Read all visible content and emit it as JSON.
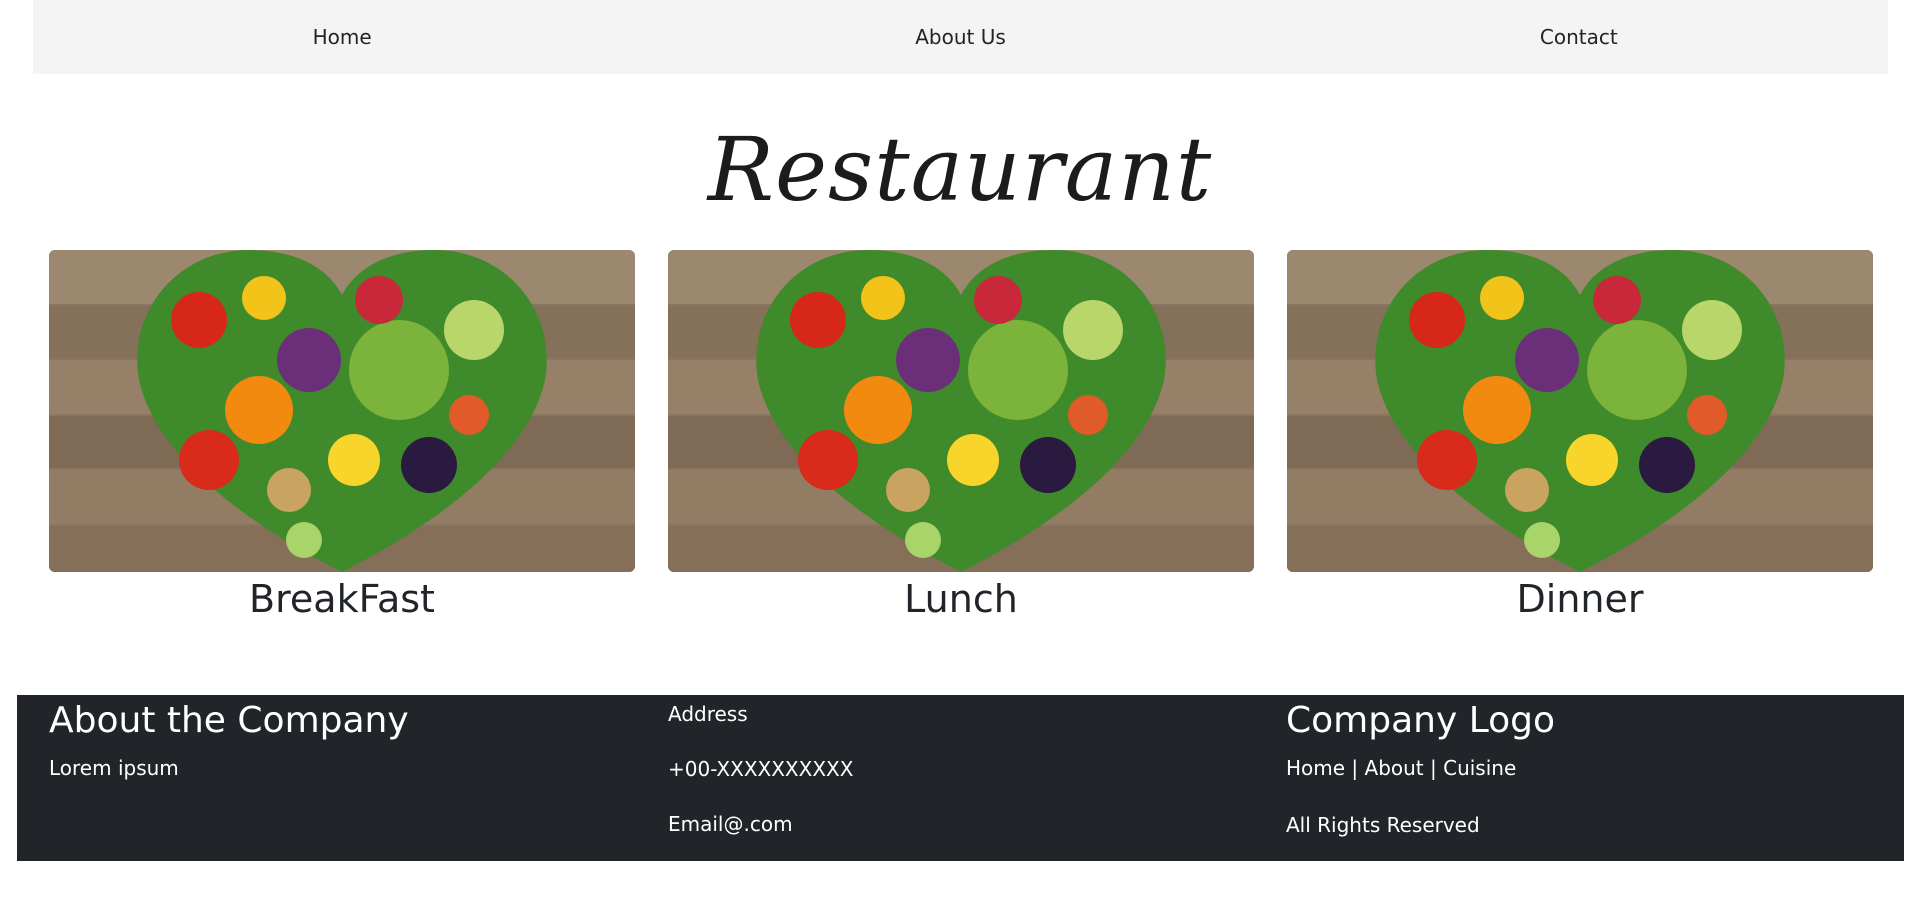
{
  "nav": {
    "items": [
      {
        "label": "Home"
      },
      {
        "label": "About Us"
      },
      {
        "label": "Contact"
      }
    ]
  },
  "brand": {
    "title": "Restaurant"
  },
  "cards": [
    {
      "title": "BreakFast",
      "image": "vegetable-heart-image"
    },
    {
      "title": "Lunch",
      "image": "vegetable-heart-image"
    },
    {
      "title": "Dinner",
      "image": "vegetable-heart-image"
    }
  ],
  "footer": {
    "about": {
      "heading": "About the Company",
      "text": "Lorem ipsum"
    },
    "contact": {
      "address": "Address",
      "phone": "+00-XXXXXXXXXX",
      "email": "Email@.com"
    },
    "company": {
      "heading": "Company Logo",
      "links": "Home | About | Cuisine",
      "rights": "All Rights Reserved"
    }
  }
}
